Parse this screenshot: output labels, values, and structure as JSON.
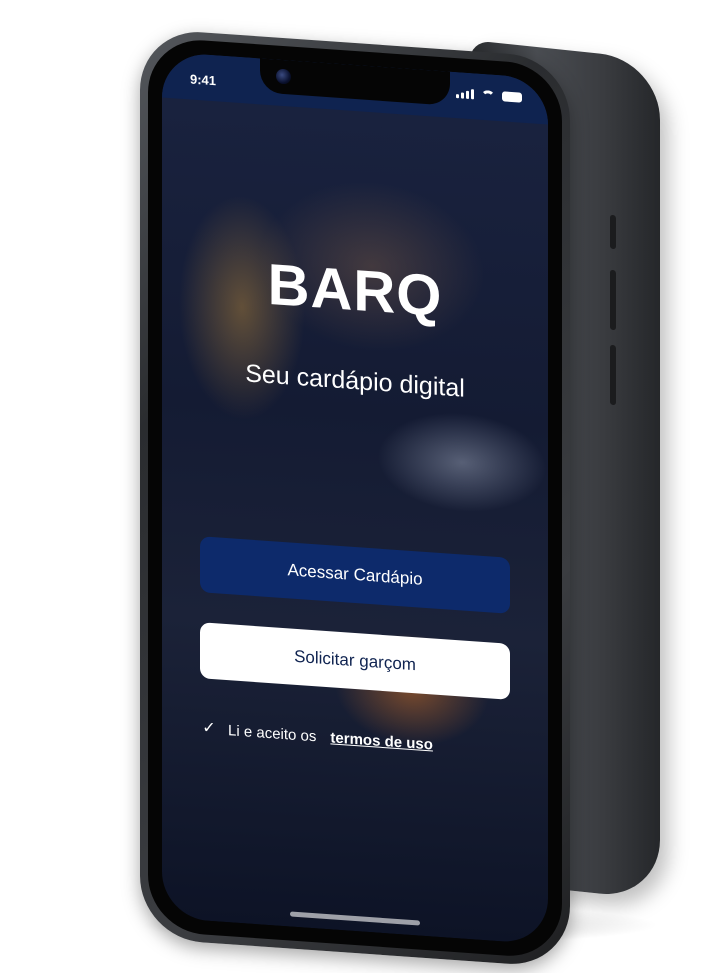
{
  "status_bar": {
    "time": "9:41"
  },
  "app": {
    "title": "BARQ",
    "subtitle": "Seu cardápio digital"
  },
  "buttons": {
    "primary_label": "Acessar Cardápio",
    "secondary_label": "Solicitar garçom"
  },
  "terms": {
    "checked": true,
    "text": "Li e aceito os",
    "link_text": "termos de uso"
  },
  "colors": {
    "brand_navy": "#0d2a6b",
    "status_bar": "#0f2350",
    "text_on_dark": "#ffffff"
  },
  "icons": {
    "check": "check-icon",
    "signal": "signal-icon",
    "wifi": "wifi-icon",
    "battery": "battery-icon"
  }
}
